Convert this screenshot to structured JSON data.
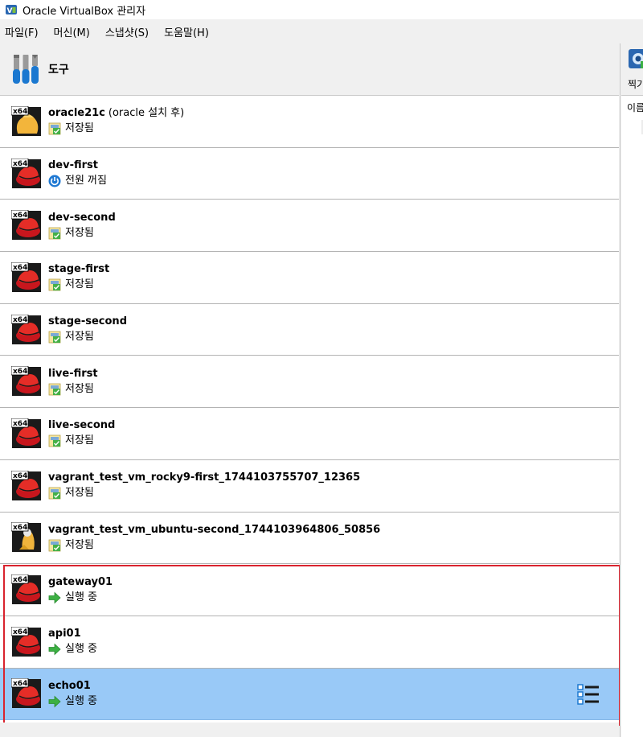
{
  "window": {
    "title": "Oracle VirtualBox 관리자",
    "logo_icon": "virtualbox-logo-icon"
  },
  "menu": [
    "파일(F)",
    "머신(M)",
    "스냅샷(S)",
    "도움말(H)"
  ],
  "tools": {
    "label": "도구",
    "icon": "tools-icon"
  },
  "vms": [
    {
      "name": "oracle21c",
      "name_suffix": "(oracle 설치 후)",
      "state": "저장됨",
      "state_icon": "saved-state-icon",
      "os_icon": "oracle-linux-icon",
      "os_badge": "x64"
    },
    {
      "name": "dev-first",
      "name_suffix": "",
      "state": "전원 꺼짐",
      "state_icon": "power-off-icon",
      "os_icon": "redhat-icon",
      "os_badge": "x64"
    },
    {
      "name": "dev-second",
      "name_suffix": "",
      "state": "저장됨",
      "state_icon": "saved-state-icon",
      "os_icon": "redhat-icon",
      "os_badge": "x64"
    },
    {
      "name": "stage-first",
      "name_suffix": "",
      "state": "저장됨",
      "state_icon": "saved-state-icon",
      "os_icon": "redhat-icon",
      "os_badge": "x64"
    },
    {
      "name": "stage-second",
      "name_suffix": "",
      "state": "저장됨",
      "state_icon": "saved-state-icon",
      "os_icon": "redhat-icon",
      "os_badge": "x64"
    },
    {
      "name": "live-first",
      "name_suffix": "",
      "state": "저장됨",
      "state_icon": "saved-state-icon",
      "os_icon": "redhat-icon",
      "os_badge": "x64"
    },
    {
      "name": "live-second",
      "name_suffix": "",
      "state": "저장됨",
      "state_icon": "saved-state-icon",
      "os_icon": "redhat-icon",
      "os_badge": "x64"
    },
    {
      "name": "vagrant_test_vm_rocky9-first_1744103755707_12365",
      "name_suffix": "",
      "state": "저장됨",
      "state_icon": "saved-state-icon",
      "os_icon": "redhat-icon",
      "os_badge": "x64"
    },
    {
      "name": "vagrant_test_vm_ubuntu-second_1744103964806_50856",
      "name_suffix": "",
      "state": "저장됨",
      "state_icon": "saved-state-icon",
      "os_icon": "linux-penguin-icon",
      "os_badge": "x64"
    },
    {
      "name": "gateway01",
      "name_suffix": "",
      "state": "실행 중",
      "state_icon": "running-arrow-icon",
      "os_icon": "redhat-icon",
      "os_badge": "x64"
    },
    {
      "name": "api01",
      "name_suffix": "",
      "state": "실행 중",
      "state_icon": "running-arrow-icon",
      "os_icon": "redhat-icon",
      "os_badge": "x64"
    },
    {
      "name": "echo01",
      "name_suffix": "",
      "state": "실행 중",
      "state_icon": "running-arrow-icon",
      "os_icon": "redhat-icon",
      "os_badge": "x64",
      "selected": true
    }
  ],
  "right_pane": {
    "toolbar_label": "찍기",
    "column_header": "이름"
  },
  "colors": {
    "selection": "#99c9f7",
    "highlight_border": "#d9232e",
    "running_green": "#3cb043",
    "power_blue": "#1e78d2"
  }
}
